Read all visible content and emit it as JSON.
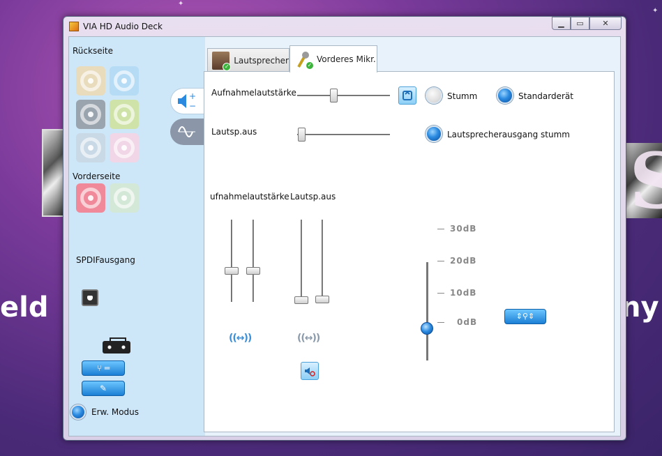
{
  "window": {
    "title": "VIA HD Audio Deck"
  },
  "background": {
    "text_left": "eld",
    "text_right": "ny"
  },
  "sidebar": {
    "rear_label": "Rückseite",
    "front_label": "Vorderseite",
    "spdif_label": "SPDIFausgang",
    "advanced_mode_label": "Erw. Modus",
    "rear_jacks": [
      {
        "name": "rear-jack-yellow",
        "color": "#e8dcbc"
      },
      {
        "name": "rear-jack-blue",
        "color": "#b6dcf5"
      },
      {
        "name": "rear-jack-gray",
        "color": "#9aa4ae"
      },
      {
        "name": "rear-jack-green",
        "color": "#cfe3a8"
      },
      {
        "name": "rear-jack-lightgray",
        "color": "#c9d9e6"
      },
      {
        "name": "rear-jack-pink",
        "color": "#f0d6e6"
      }
    ],
    "front_jacks": [
      {
        "name": "front-jack-red",
        "color": "#f08a9a"
      },
      {
        "name": "front-jack-green",
        "color": "#d4e8d8"
      }
    ]
  },
  "tabs": {
    "speaker": "Lautsprecher",
    "front_mic": "Vorderes Mikr."
  },
  "controls": {
    "record_volume_label": "Aufnahmelautstärke",
    "record_volume_level": 0.4,
    "mute_label": "Stumm",
    "default_device_label": "Standarderät",
    "speaker_out_label": "Lautsp.aus",
    "speaker_out_level": 0.0,
    "speaker_out_mute_label": "Lautsprecherausgang stumm",
    "mixer_record_label": "ufnahmelautstärke",
    "mixer_speaker_label": "Lautsp.aus",
    "mixer_record_levels": [
      0.4,
      0.4
    ],
    "mixer_speaker_levels": [
      0.0,
      0.0
    ]
  },
  "boost": {
    "levels": [
      "30dB",
      "20dB",
      "10dB",
      "0dB"
    ],
    "selected": "10dB"
  },
  "colors": {
    "accent_blue": "#1c7fd4",
    "sidebar_bg": "#cde6f8"
  }
}
